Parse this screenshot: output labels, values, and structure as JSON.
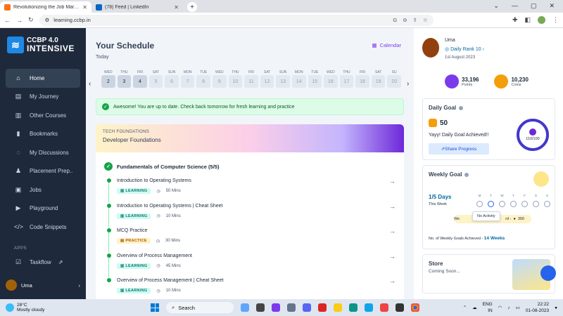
{
  "browser": {
    "tabs": [
      {
        "title": "Revolutionizing the Job Market",
        "active": true,
        "favicon_color": "#f97316"
      },
      {
        "title": "(78) Feed | LinkedIn",
        "active": false,
        "favicon_color": "#0a66c2"
      }
    ],
    "url": "learning.ccbp.in"
  },
  "sidebar": {
    "logo_line1": "CCBP 4.0",
    "logo_line2": "INTENSIVE",
    "items": [
      {
        "label": "Home",
        "icon": "⌂",
        "active": true
      },
      {
        "label": "My Journey",
        "icon": "▤"
      },
      {
        "label": "Other Courses",
        "icon": "▥"
      },
      {
        "label": "Bookmarks",
        "icon": "▮"
      },
      {
        "label": "My Discussions",
        "icon": "◌"
      },
      {
        "label": "Placement Prep..",
        "icon": "♟"
      },
      {
        "label": "Jobs",
        "icon": "▣"
      },
      {
        "label": "Playground",
        "icon": "▶"
      },
      {
        "label": "Code Snippets",
        "icon": "</>"
      }
    ],
    "apps_heading": "APPS",
    "app_item": {
      "label": "Taskflow",
      "icon": "☑",
      "ext": "⇗"
    },
    "user": "Uma"
  },
  "schedule": {
    "title": "Your Schedule",
    "subtitle": "Today",
    "calendar_label": "Calendar",
    "days": [
      {
        "dn": "WED",
        "dd": "2",
        "done": true
      },
      {
        "dn": "THU",
        "dd": "3",
        "done": true
      },
      {
        "dn": "FRI",
        "dd": "4",
        "done": true
      },
      {
        "dn": "SAT",
        "dd": "5"
      },
      {
        "dn": "SUN",
        "dd": "6"
      },
      {
        "dn": "MON",
        "dd": "7"
      },
      {
        "dn": "TUE",
        "dd": "8"
      },
      {
        "dn": "WED",
        "dd": "9"
      },
      {
        "dn": "THU",
        "dd": "10"
      },
      {
        "dn": "FRI",
        "dd": "11"
      },
      {
        "dn": "SAT",
        "dd": "12"
      },
      {
        "dn": "SUN",
        "dd": "13"
      },
      {
        "dn": "MON",
        "dd": "14"
      },
      {
        "dn": "TUE",
        "dd": "15"
      },
      {
        "dn": "WED",
        "dd": "16"
      },
      {
        "dn": "THU",
        "dd": "17"
      },
      {
        "dn": "FRI",
        "dd": "18"
      },
      {
        "dn": "SAT",
        "dd": "19"
      },
      {
        "dn": "SU",
        "dd": "20"
      }
    ],
    "banner": "Awesome! You are up to date. Check back tomorrow for fresh learning and practice",
    "track": "TECH FOUNDATIONS",
    "module": "Developer Foundations",
    "course": "Fundamentals of Computer Science (5/5)",
    "lessons": [
      {
        "title": "Introduction to Operating Systems",
        "type": "LEARNING",
        "duration": "50 Mins"
      },
      {
        "title": "Introduction to Operating Systems | Cheat Sheet",
        "type": "LEARNING",
        "duration": "10 Mins"
      },
      {
        "title": "MCQ Practice",
        "type": "PRACTICE",
        "duration": "30 Mins"
      },
      {
        "title": "Overview of Process Management",
        "type": "LEARNING",
        "duration": "45 Mins"
      },
      {
        "title": "Overview of Process Management | Cheat Sheet",
        "type": "LEARNING",
        "duration": "10 Mins"
      }
    ]
  },
  "profile": {
    "name": "Uma",
    "rank": "Daily Rank 10",
    "joined": "1st August 2023",
    "points_value": "33,196",
    "points_label": "Points",
    "coins_value": "10,230",
    "coins_label": "Coins"
  },
  "daily_goal": {
    "title": "Daily Goal",
    "count": "50",
    "message": "Yayy! Daily Goal Achieved!!",
    "share_label": "Share Progress",
    "progress": "110/100"
  },
  "weekly_goal": {
    "title": "Weekly Goal",
    "days_label": "1/5 Days",
    "week_label": "This Week",
    "days": [
      {
        "l": "M"
      },
      {
        "l": "T",
        "done": true
      },
      {
        "l": "W"
      },
      {
        "l": "T"
      },
      {
        "l": "F"
      },
      {
        "l": "S"
      },
      {
        "l": "S"
      }
    ],
    "tooltip": "No Activity",
    "reward_left": "We",
    "reward_right": "rd -",
    "reward_value": "300",
    "footer_label": "No. of Weekly Goals Achieved -",
    "footer_value": "14 Weeks"
  },
  "store": {
    "title": "Store",
    "subtitle": "Coming Soon..."
  },
  "taskbar": {
    "temp": "28°C",
    "weather": "Mostly cloudy",
    "search": "Search",
    "lang1": "ENG",
    "lang2": "IN",
    "time": "22:22",
    "date": "01-08-2023"
  }
}
